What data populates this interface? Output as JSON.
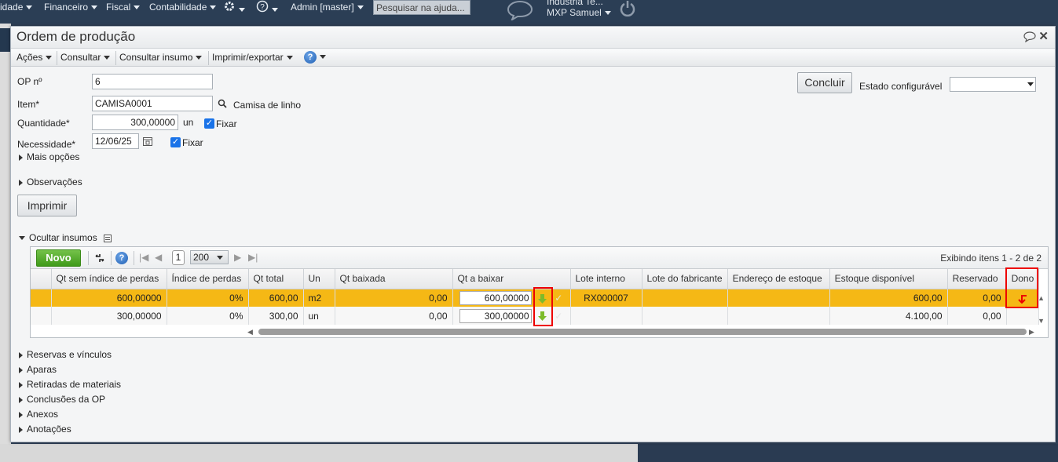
{
  "topnav": {
    "items": [
      "idade",
      "Financeiro",
      "Fiscal",
      "Contabilidade"
    ],
    "admin": "Admin [master]",
    "search_placeholder": "Pesquisar na ajuda...",
    "company": "Indústria Te...",
    "user": "MXP Samuel"
  },
  "dialog": {
    "title": "Ordem de produção",
    "toolbar": [
      "Ações",
      "Consultar",
      "Consultar insumo",
      "Imprimir/exportar"
    ]
  },
  "form": {
    "op_label": "OP nº",
    "op_value": "6",
    "item_label": "Item*",
    "item_value": "CAMISA0001",
    "item_desc": "Camisa de linho",
    "qty_label": "Quantidade*",
    "qty_value": "300,00000",
    "qty_unit": "un",
    "fixar": "Fixar",
    "need_label": "Necessidade*",
    "need_value": "12/06/25",
    "mais_opcoes": "Mais opções",
    "observacoes": "Observações",
    "imprimir": "Imprimir",
    "concluir": "Concluir",
    "estado_label": "Estado configurável",
    "estado_value": ""
  },
  "insumos": {
    "toggle": "Ocultar insumos",
    "novo": "Novo",
    "page": "1",
    "page_size": "200",
    "info": "Exibindo itens 1 - 2 de 2",
    "columns": [
      "Qt sem índice de perdas",
      "Índice de perdas",
      "Qt total",
      "Un",
      "Qt baixada",
      "Qt a baixar",
      "Lote interno",
      "Lote do fabricante",
      "Endereço de estoque",
      "Estoque disponível",
      "Reservado",
      "Dono"
    ],
    "rows": [
      {
        "qt_sem": "600,00000",
        "indice": "0%",
        "qt_total": "600,00",
        "un": "m2",
        "baixada": "0,00",
        "a_baixar": "600,00000",
        "lote": "RX000007",
        "lote_fab": "",
        "endereco": "",
        "estoque": "600,00",
        "reservado": "0,00",
        "dono": "return-arrow-icon"
      },
      {
        "qt_sem": "300,00000",
        "indice": "0%",
        "qt_total": "300,00",
        "un": "un",
        "baixada": "0,00",
        "a_baixar": "300,00000",
        "lote": "",
        "lote_fab": "",
        "endereco": "",
        "estoque": "4.100,00",
        "reservado": "0,00",
        "dono": ""
      }
    ]
  },
  "sections": [
    "Reservas e vínculos",
    "Aparas",
    "Retiradas de materiais",
    "Conclusões da OP",
    "Anexos",
    "Anotações"
  ],
  "colors": {
    "accent_row": "#f5b815",
    "highlight": "#e00000",
    "novo": "#4aa321"
  }
}
